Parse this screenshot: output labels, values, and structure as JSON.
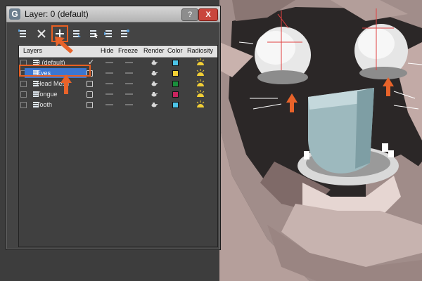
{
  "dialog": {
    "title": "Layer: 0 (default)",
    "help_label": "?",
    "close_label": "X",
    "toolbar": [
      {
        "name": "create-layer",
        "icon": "stack-icon"
      },
      {
        "name": "delete-layer",
        "icon": "x-icon"
      },
      {
        "name": "add-selection-to-layer",
        "icon": "plus-icon"
      },
      {
        "name": "select-objects-in-layer",
        "icon": "stack-select-icon"
      },
      {
        "name": "highlight-selected",
        "icon": "stack-cursor-icon"
      },
      {
        "name": "hide-unhide-all",
        "icon": "stack-eye-icon"
      },
      {
        "name": "freeze-unfreeze-all",
        "icon": "stack-snow-icon"
      }
    ]
  },
  "grid": {
    "columns": [
      "Layers",
      "Hide",
      "Freeze",
      "Render",
      "Color",
      "Radiosity"
    ],
    "rows": [
      {
        "name": "0 (default)",
        "active": true,
        "color": "#4cc4e8",
        "selected": false
      },
      {
        "name": "Eyes",
        "active": false,
        "color": "#f2cf35",
        "selected": true
      },
      {
        "name": "Head Mesh",
        "active": false,
        "color": "#1a8f3c",
        "selected": false
      },
      {
        "name": "Tongue",
        "active": false,
        "color": "#c8245e",
        "selected": false
      },
      {
        "name": "Tooth",
        "active": false,
        "color": "#4cc4e8",
        "selected": false
      }
    ]
  },
  "colors": {
    "highlight": "#e85f22",
    "selection": "#3b76d1"
  }
}
